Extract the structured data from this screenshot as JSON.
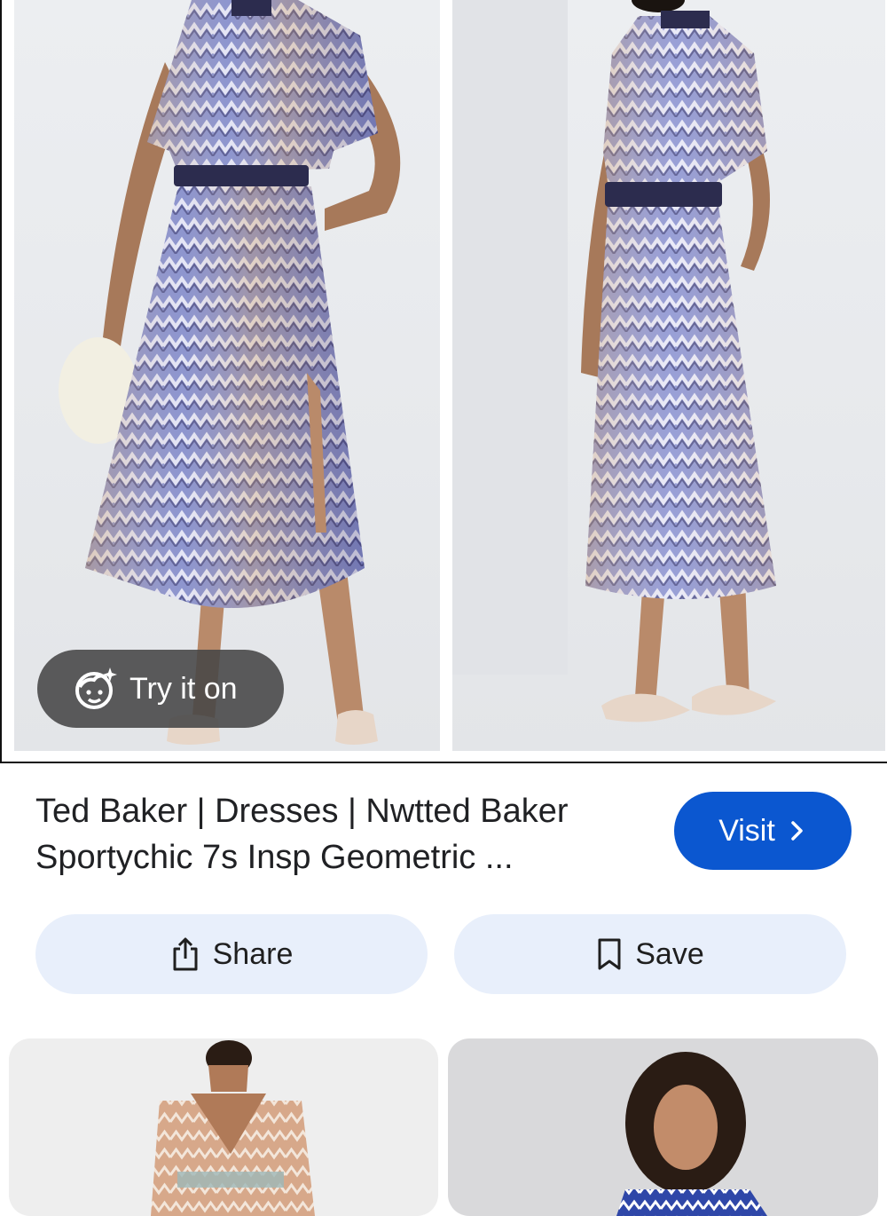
{
  "hero": {
    "try_it_on_label": "Try it on",
    "try_icon": "face-sparkle-icon",
    "image_left_alt": "Model wearing geometric zigzag midi dress, front view",
    "image_right_alt": "Model wearing geometric zigzag midi dress, side view"
  },
  "listing": {
    "title_line1": "Ted Baker | Dresses | Nwtted Baker",
    "title_line2": "Sportychic 7s Insp Geometric ...",
    "visit_label": "Visit",
    "visit_icon": "chevron-right-icon"
  },
  "actions": {
    "share_label": "Share",
    "share_icon": "share-icon",
    "save_label": "Save",
    "save_icon": "bookmark-icon"
  },
  "colors": {
    "accent": "#0b57d0",
    "action_bg": "#e8effb",
    "chip_bg": "#464646"
  }
}
